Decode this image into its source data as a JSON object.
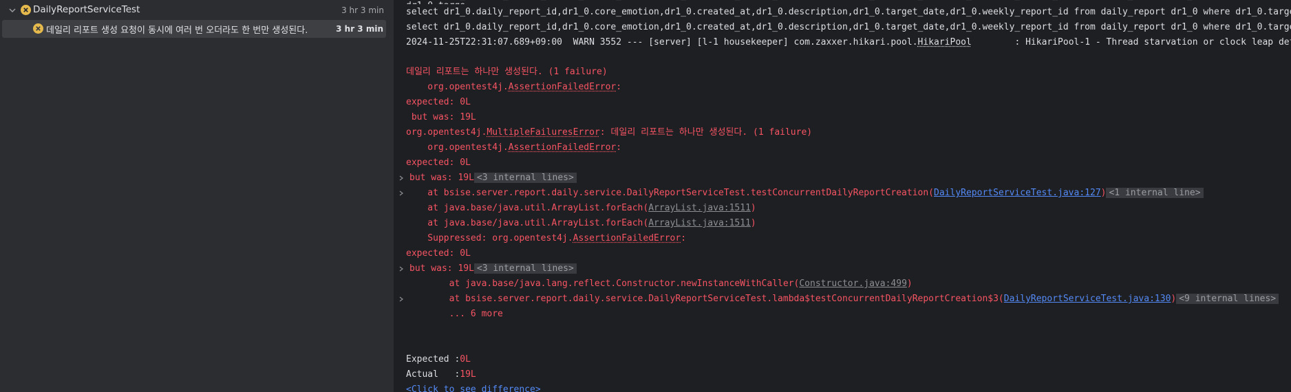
{
  "tree": {
    "suite": {
      "name": "DailyReportServiceTest",
      "time": "3 hr 3 min"
    },
    "test": {
      "name": "데일리 리포트 생성 요청이 동시에 여러 번 오더라도 한 번만 생성된다.",
      "time": "3 hr 3 min"
    }
  },
  "console": {
    "sql1": "select dr1_0.daily_report_id,dr1_0.core_emotion,dr1_0.created_at,dr1_0.description,dr1_0.target_date,dr1_0.weekly_report_id from daily_report dr1_0 where dr1_0.targe",
    "sql2": "select dr1_0.daily_report_id,dr1_0.core_emotion,dr1_0.created_at,dr1_0.description,dr1_0.target_date,dr1_0.weekly_report_id from daily_report dr1_0 where dr1_0.targe",
    "warn_prefix": "2024-11-25T22:31:07.689+09:00  WARN 3552 --- [server] [l-1 housekeeper] com.zaxxer.hikari.pool.",
    "warn_class": "HikariPool",
    "warn_suffix": "        : HikariPool-1 - Thread starvation or clock leap det",
    "fail_title": "데일리 리포트는 하나만 생성된다. (1 failure)",
    "pkg_indent": "    org.opentest4j.",
    "assertion_error": "AssertionFailedError",
    "colon": ":",
    "expected_line": "expected: 0L",
    "but_was_sp": " but was: 19L",
    "pkg_org": "org.opentest4j.",
    "multiple_error": "MultipleFailuresError",
    "multi_msg": ": 데일리 리포트는 하나만 생성된다. (1 failure)",
    "but_was": "but was: 19L",
    "internal_3": "<3 internal lines>",
    "at1_prefix": "    at bsise.server.report.daily.service.DailyReportServiceTest.testConcurrentDailyReportCreation(",
    "at1_link": "DailyReportServiceTest.java:127",
    "close_paren": ")",
    "internal_1": "<1 internal line>",
    "at_foreach_prefix": "    at java.base/java.util.ArrayList.forEach(",
    "arraylist_link": "ArrayList.java:1511",
    "suppressed_prefix": "    Suppressed: org.opentest4j.",
    "at_ctor_prefix": "        at java.base/java.lang.reflect.Constructor.newInstanceWithCaller(",
    "ctor_link": "Constructor.java:499",
    "at_lambda_prefix": "        at bsise.server.report.daily.service.DailyReportServiceTest.lambda$testConcurrentDailyReportCreation$3(",
    "lambda_link": "DailyReportServiceTest.java:130",
    "internal_9": "<9 internal lines>",
    "more": "        ... 6 more",
    "expected_label": "Expected :",
    "expected_value": "0L",
    "actual_label": "Actual   :",
    "actual_value": "19L",
    "click_diff": "<Click to see difference>"
  },
  "colors": {
    "error": "#f75464",
    "link": "#548af7",
    "fail_icon": "#e6b94d",
    "selection": "#3d3f43"
  }
}
